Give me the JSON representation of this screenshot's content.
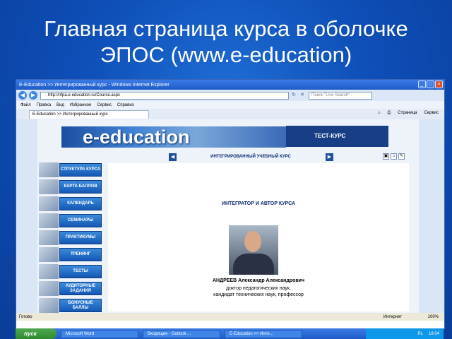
{
  "slide": {
    "title_line1": "Главная страница курса в оболочке",
    "title_line2": "ЭПОС (www.e-education)"
  },
  "browser": {
    "title": "E-Education >> Интегрированный курс - Windows Internet Explorer",
    "url": "http://nfpa.e-education.ru/Course.aspx",
    "search_placeholder": "Поиск \"Live Search\"",
    "menu": [
      "Файл",
      "Правка",
      "Вид",
      "Избранное",
      "Сервис",
      "Справка"
    ],
    "tab_label": "E-Education >> Интегрированный курс",
    "tools": {
      "page": "Страница",
      "service": "Сервис"
    },
    "status": {
      "left": "Готово",
      "right": "Интернет",
      "zoom": "100%"
    }
  },
  "page": {
    "logo_text": "e-education",
    "test_banner": "ТЕСТ-КУРС",
    "course_title": "ИНТЕГРИРОВАННЫЙ УЧЕБНЫЙ КУРС",
    "menu_items": [
      "СТРУКТУРА КУРСА",
      "КАРТА БАЛЛОВ",
      "КАЛЕНДАРЬ",
      "СЕМИНАРЫ",
      "ПРАКТИКУМЫ",
      "ТРЕНИНГ",
      "ТЕСТЫ",
      "АУДИТОРНЫЕ ЗАДАНИЯ",
      "БОНУСНЫЕ БАЛЛЫ"
    ],
    "author_heading": "ИНТЕГРАТОР И АВТОР КУРСА",
    "author_name": "АНДРЕЕВ Александр Александрович",
    "author_degree1": "доктор педагогических наук,",
    "author_degree2": "кандидат технических наук, профессор"
  },
  "taskbar": {
    "start": "пуск",
    "tasks": [
      "Microsoft Word",
      "Входящие - Outlook ...",
      "E-Education >> Инте..."
    ],
    "lang": "RL",
    "clock": "18:04"
  },
  "icons": [
    "back-icon",
    "forward-icon",
    "refresh-icon",
    "stop-icon",
    "home-icon",
    "print-icon",
    "prev-arrow-icon",
    "next-arrow-icon"
  ]
}
